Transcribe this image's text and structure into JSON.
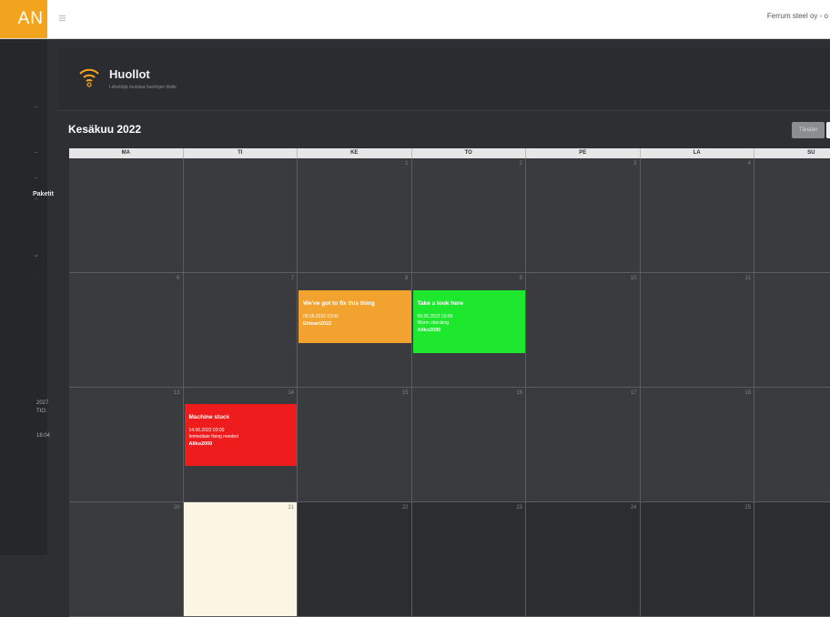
{
  "brand": {
    "logo_text": "AN",
    "accent_color": "#f2a41e"
  },
  "topbar": {
    "user_text": "Ferrum steel oy - o"
  },
  "sidebar": {
    "label": "Paketit",
    "info_lines": [
      "2027",
      "TIO.",
      "",
      "18:04"
    ]
  },
  "header": {
    "title": "Huollot",
    "subtitle": "Lähettäjä muistaa huoltojen tilalle"
  },
  "calendar": {
    "month_label": "Kesäkuu 2022",
    "today_button": "Tänään",
    "weekdays": [
      "MA",
      "TI",
      "KE",
      "TO",
      "PE",
      "LA",
      "SU"
    ],
    "weeks": [
      [
        "",
        "",
        "1",
        "2",
        "3",
        "4",
        ""
      ],
      [
        "6",
        "7",
        "8",
        "9",
        "10",
        "11",
        ""
      ],
      [
        "13",
        "14",
        "15",
        "16",
        "17",
        "18",
        ""
      ],
      [
        "20",
        "21",
        "22",
        "23",
        "24",
        "25",
        ""
      ]
    ],
    "events": [
      {
        "title": "We've got to fix this thing",
        "date": "08.06.2022 03:00",
        "note": "",
        "user": "Ehtoari2022",
        "color": "#f2a22e"
      },
      {
        "title": "Take a look here",
        "date": "09.06.2022 03:00",
        "note": "Worm checking",
        "user": "Aliko2000",
        "color": "#1de82e"
      },
      {
        "title": "Machine stuck",
        "date": "14.06.2022 03:00",
        "note": "Immediate fixing needed",
        "user": "Aliko2000",
        "color": "#ee1c1c"
      }
    ]
  }
}
